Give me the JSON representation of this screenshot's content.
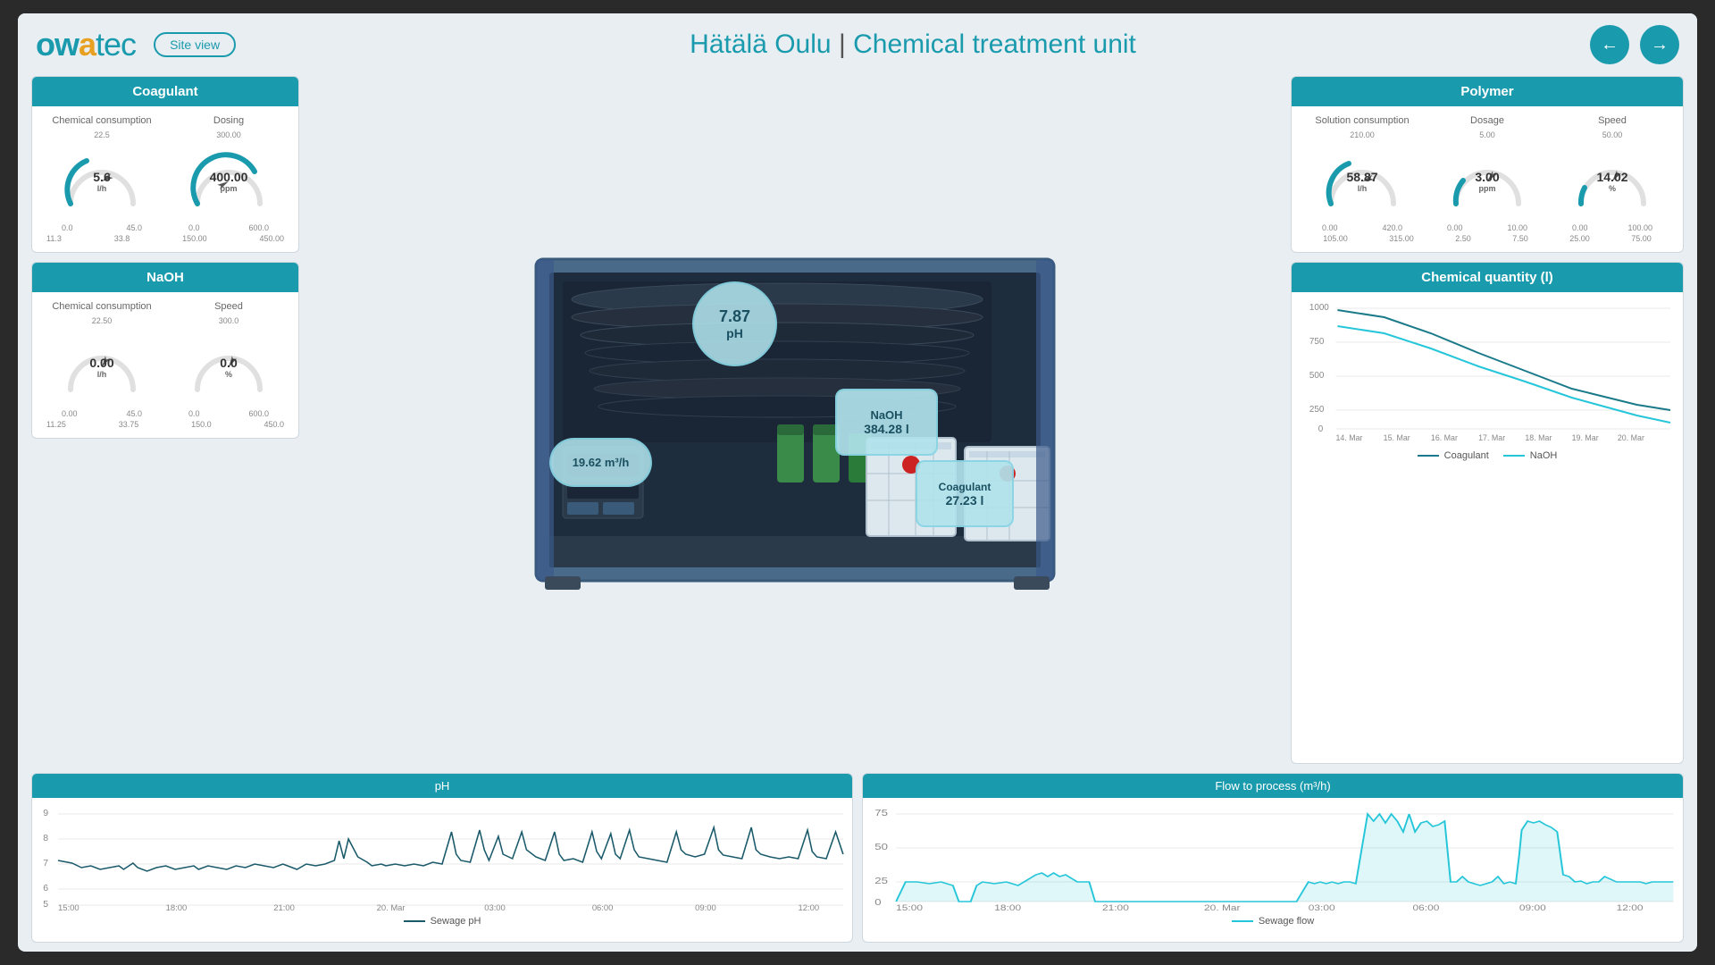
{
  "header": {
    "logo": "owatec",
    "site_view_label": "Site view",
    "title_prefix": "Hätälä Oulu",
    "title_separator": "|",
    "title_main": "Chemical treatment unit",
    "nav_back_icon": "←",
    "nav_forward_icon": "→"
  },
  "coagulant_panel": {
    "title": "Coagulant",
    "chemical_consumption": {
      "label": "Chemical consumption",
      "value": "5.6",
      "unit": "l/h",
      "min": "0.0",
      "max": "45.0",
      "mid_left": "11.3",
      "mid_right": "33.8",
      "top": "22.5"
    },
    "dosing": {
      "label": "Dosing",
      "value": "400.00",
      "unit": "ppm",
      "min": "0.0",
      "max": "600.0",
      "mid_left": "150.00",
      "mid_right": "450.00",
      "top": "300.00"
    }
  },
  "naoh_panel": {
    "title": "NaOH",
    "chemical_consumption": {
      "label": "Chemical consumption",
      "value": "0.00",
      "unit": "l/h",
      "min": "0.00",
      "max": "45.0",
      "mid_left": "11.25",
      "mid_right": "33.75",
      "top": "22.50"
    },
    "speed": {
      "label": "Speed",
      "value": "0.0",
      "unit": "%",
      "min": "0.0",
      "max": "600.0",
      "mid_left": "150.0",
      "mid_right": "450.0",
      "top": "300.0"
    }
  },
  "bubbles": {
    "ph": {
      "value": "7.87",
      "unit": "pH"
    },
    "flow": {
      "value": "19.62 m³/h"
    },
    "naoh": {
      "label": "NaOH",
      "value": "384.28 l"
    },
    "coagulant": {
      "label": "Coagulant",
      "value": "27.23 l"
    }
  },
  "polymer_panel": {
    "title": "Polymer",
    "solution_consumption": {
      "label": "Solution consumption",
      "value": "58.87",
      "unit": "l/h",
      "min": "0.00",
      "max": "420.0",
      "mid_left": "105.00",
      "mid_right": "315.00",
      "top": "210.00"
    },
    "dosage": {
      "label": "Dosage",
      "value": "3.00",
      "unit": "ppm",
      "min": "0.00",
      "max": "10.00",
      "mid_left": "2.50",
      "mid_right": "7.50",
      "top": "5.00"
    },
    "speed": {
      "label": "Speed",
      "value": "14.02",
      "unit": "%",
      "min": "0.00",
      "max": "100.00",
      "mid_left": "25.00",
      "mid_right": "75.00",
      "top": "50.00"
    }
  },
  "chemical_quantity_chart": {
    "title": "Chemical quantity (l)",
    "y_labels": [
      "1000",
      "750",
      "500",
      "250",
      "0"
    ],
    "x_labels": [
      "14. Mar",
      "15. Mar",
      "16. Mar",
      "17. Mar",
      "18. Mar",
      "19. Mar",
      "20. Mar"
    ],
    "legend": [
      {
        "label": "Coagulant",
        "color": "#1a7a8a"
      },
      {
        "label": "NaOH",
        "color": "#26c6da"
      }
    ]
  },
  "ph_chart": {
    "title": "pH",
    "y_labels": [
      "9",
      "8",
      "7",
      "6",
      "5"
    ],
    "x_labels": [
      "15:00",
      "18:00",
      "21:00",
      "20. Mar",
      "03:00",
      "06:00",
      "09:00",
      "12:00"
    ],
    "legend": [
      {
        "label": "Sewage pH",
        "color": "#1a5a6a"
      }
    ]
  },
  "flow_chart": {
    "title": "Flow to process (m³/h)",
    "y_labels": [
      "75",
      "50",
      "25",
      "0"
    ],
    "x_labels": [
      "15:00",
      "18:00",
      "21:00",
      "20. Mar",
      "03:00",
      "06:00",
      "09:00",
      "12:00"
    ],
    "legend": [
      {
        "label": "Sewage flow",
        "color": "#26c6da"
      }
    ]
  }
}
